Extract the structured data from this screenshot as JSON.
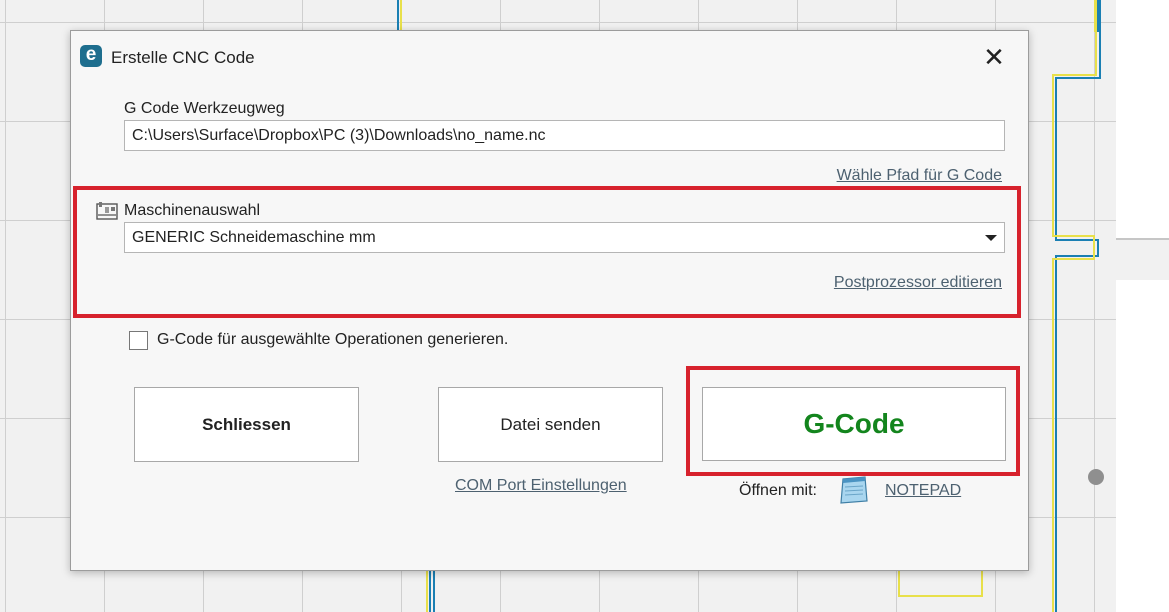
{
  "dialog": {
    "title": "Erstelle CNC Code",
    "close_glyph": "✕",
    "app_icon": "e",
    "gcode_path": {
      "label": "G Code Werkzeugweg",
      "value": "C:\\Users\\Surface\\Dropbox\\PC (3)\\Downloads\\no_name.nc",
      "choose_link": "Wähle Pfad für G Code"
    },
    "machine": {
      "label": "Maschinenauswahl",
      "selected": "GENERIC Schneidemaschine mm",
      "edit_link": "Postprozessor editieren"
    },
    "selected_ops": {
      "label": "G-Code für ausgewählte Operationen generieren.",
      "checked": false
    },
    "buttons": {
      "close": "Schliessen",
      "send": "Datei senden",
      "gcode": "G-Code"
    },
    "com_port_link": "COM Port Einstellungen",
    "open_with": {
      "label": "Öffnen mit:",
      "app": "NOTEPAD"
    }
  },
  "colors": {
    "highlight": "#d7222d",
    "gcode_text": "#13851d",
    "link": "#4d6170",
    "app_icon": "#1e6e8e"
  }
}
